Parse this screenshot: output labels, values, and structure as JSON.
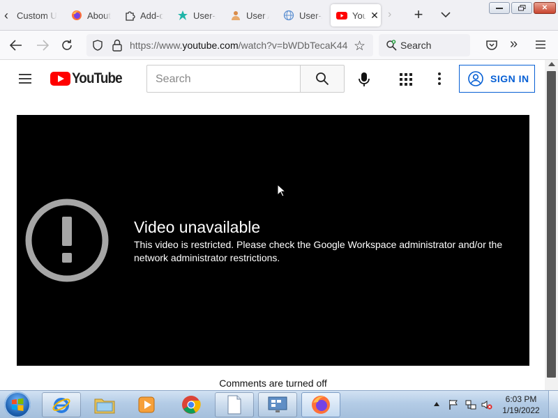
{
  "browser": {
    "tabs": [
      {
        "label": "Custom U",
        "icon": "page-icon",
        "active": false
      },
      {
        "label": "About",
        "icon": "firefox-icon",
        "active": false
      },
      {
        "label": "Add-ons",
        "icon": "puzzle-icon",
        "active": false
      },
      {
        "label": "User-A",
        "icon": "teal-star-icon",
        "active": false
      },
      {
        "label": "User A",
        "icon": "user-icon",
        "active": false
      },
      {
        "label": "User-A",
        "icon": "globe-icon",
        "active": false
      },
      {
        "label": "YouTube",
        "icon": "youtube-icon",
        "active": true
      }
    ],
    "url_prefix": "https://www.",
    "url_domain": "youtube.com",
    "url_path": "/watch?v=bWDbTecaK44",
    "search_placeholder": "Search"
  },
  "youtube": {
    "logo_text": "YouTube",
    "search_placeholder": "Search",
    "sign_in_label": "SIGN IN",
    "player": {
      "title": "Video unavailable",
      "message": "This video is restricted. Please check the Google Workspace administrator and/or the network administrator restrictions."
    },
    "comments_status": "Comments are turned off"
  },
  "taskbar": {
    "time": "6:03 PM",
    "date": "1/19/2022"
  },
  "colors": {
    "youtube_red": "#ff0000",
    "signin_blue": "#065fd4"
  }
}
